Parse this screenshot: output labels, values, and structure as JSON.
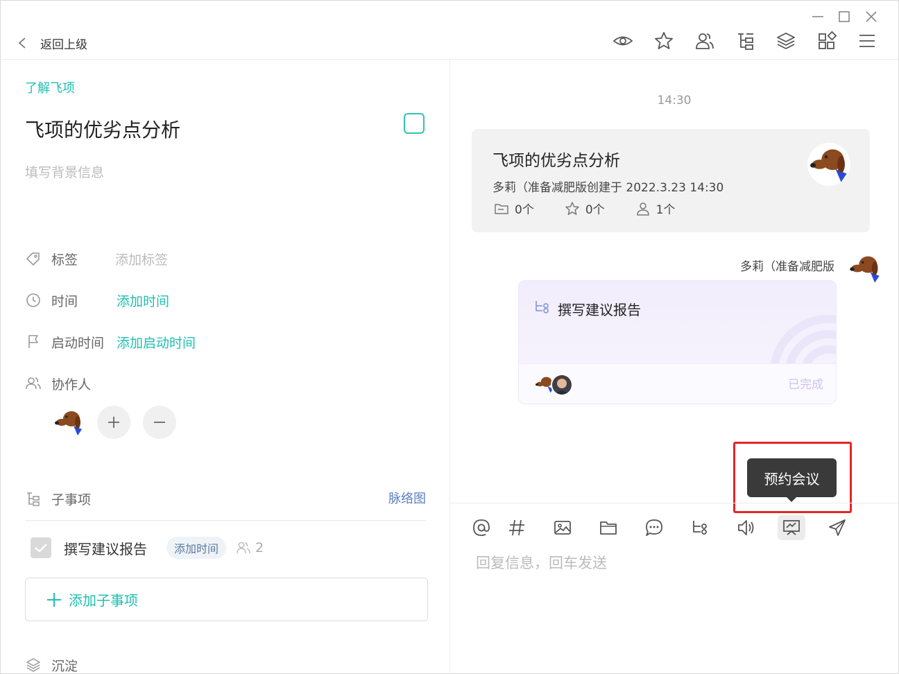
{
  "window": {
    "back_label": "返回上级",
    "controls": [
      "minimize-icon",
      "maximize-icon",
      "close-icon"
    ]
  },
  "toolbar": {
    "icons": [
      "eye-icon",
      "star-icon",
      "members-icon",
      "subtask-tree-icon",
      "layers-icon",
      "apps-grid-icon",
      "menu-icon"
    ]
  },
  "task": {
    "project": "了解飞项",
    "title": "飞项的优劣点分析",
    "background_placeholder": "填写背景信息",
    "fields": {
      "tag_label": "标签",
      "tag_value": "添加标签",
      "time_label": "时间",
      "time_value": "添加时间",
      "start_label": "启动时间",
      "start_value": "添加启动时间",
      "collab_label": "协作人"
    },
    "subtasks": {
      "label": "子事项",
      "mind_map": "脉络图",
      "items": [
        {
          "name": "撰写建议报告",
          "time_chip": "添加时间",
          "member_count": "2",
          "done": true
        }
      ],
      "add_label": "添加子事项"
    },
    "settle_label": "沉淀"
  },
  "chat": {
    "timestamp": "14:30",
    "card": {
      "title": "飞项的优劣点分析",
      "meta": "多莉（准备减肥版创建于 2022.3.23 14:30",
      "folders": "0个",
      "stars": "0个",
      "members": "1个"
    },
    "message": {
      "sender": "多莉（准备减肥版",
      "subtask_title": "撰写建议报告",
      "status": "已完成"
    },
    "tooltip": "预约会议",
    "input_tools": [
      "at-icon",
      "hashtag-icon",
      "image-icon",
      "folder-icon",
      "chat-bubble-icon",
      "subtask-icon",
      "speaker-icon",
      "meeting-icon",
      "send-icon"
    ],
    "reply_placeholder": "回复信息，回车发送"
  },
  "colors": {
    "accent": "#1fbfb0",
    "link_blue": "#5a7fc0",
    "highlight_box": "#e62424",
    "tooltip_bg": "#3a3a3a"
  }
}
